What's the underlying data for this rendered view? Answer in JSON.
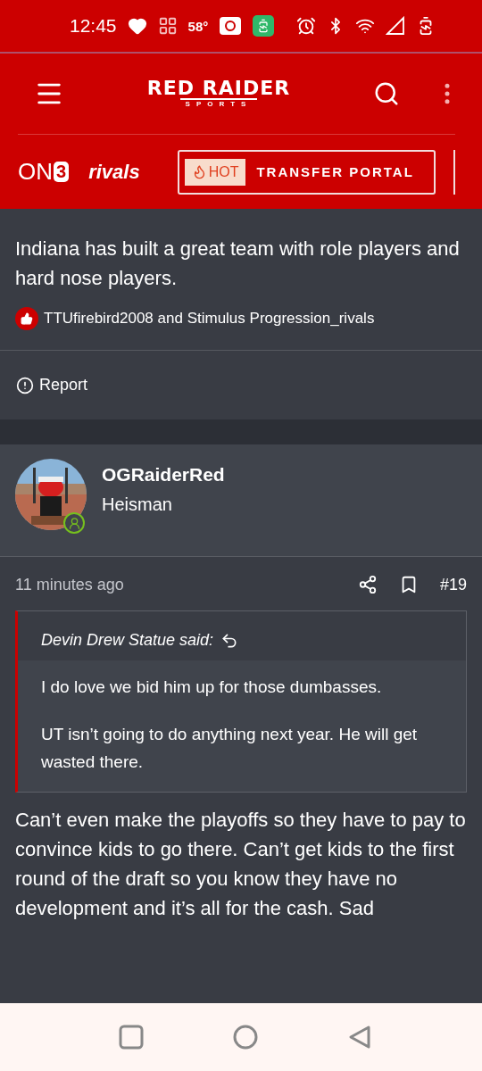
{
  "status_bar": {
    "time": "12:45",
    "temperature": "58°"
  },
  "header": {
    "logo_title": "RED RAIDER",
    "logo_subtitle": "SPORTS"
  },
  "partner_bar": {
    "on3_text": "ON",
    "on3_digit": "3",
    "rivals": "rivals",
    "hot_badge": "HOT",
    "portal_link": "TRANSFER PORTAL"
  },
  "posts": [
    {
      "kind": "continued",
      "body": "Indiana has built a great team with role players and hard nose players.",
      "reactions": "TTUfirebird2008 and Stimulus Progression_rivals",
      "report": "Report"
    },
    {
      "kind": "full",
      "author": "OGRaiderRed",
      "rank": "Heisman",
      "online": true,
      "time": "11 minutes ago",
      "number": "#19",
      "quote": {
        "author": "Devin Drew Statue said:",
        "paragraphs": [
          "I do love we bid him up for those dumbasses.",
          "UT isn’t going to do anything next year. He will get wasted there."
        ]
      },
      "body": "Can’t even make the playoffs so they have to pay to convince kids to go there. Can’t get kids to the first round of the draft so you know they have no development and it’s all for the cash. Sad"
    }
  ]
}
